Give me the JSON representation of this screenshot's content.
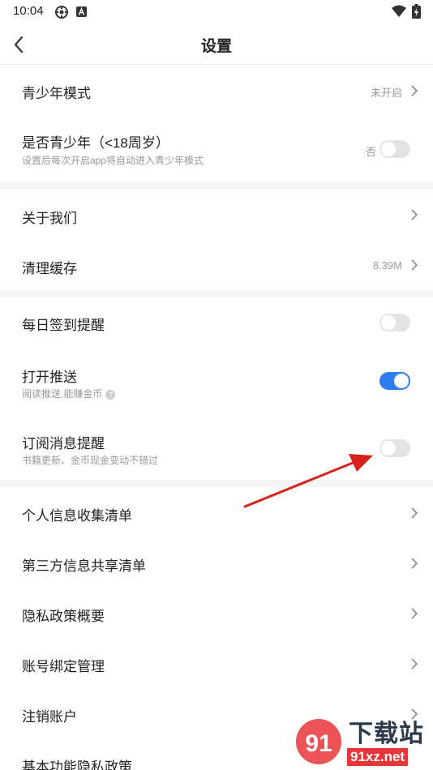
{
  "status": {
    "time": "10:04",
    "icons": [
      "location-icon",
      "a-badge-icon",
      "wifi-icon",
      "battery-icon"
    ]
  },
  "header": {
    "title": "设置",
    "back_icon": "chevron-left-icon"
  },
  "section1": {
    "youth_mode": {
      "label": "青少年模式",
      "value": "未开启"
    },
    "is_youth": {
      "label": "是否青少年（<18周岁）",
      "sub": "设置后每次开启app将自动进入青少年模式",
      "value": "否",
      "enabled": false
    }
  },
  "section2": {
    "about": {
      "label": "关于我们"
    },
    "cache": {
      "label": "清理缓存",
      "value": "8.39M"
    }
  },
  "section3": {
    "checkin": {
      "label": "每日签到提醒",
      "enabled": false
    },
    "push": {
      "label": "打开推送",
      "sub": "阅读推送,能赚金币",
      "help": "?",
      "enabled": true
    },
    "subscribe": {
      "label": "订阅消息提醒",
      "sub": "书籍更新、金币现金变动不错过",
      "enabled": false
    }
  },
  "section4": {
    "items": [
      {
        "label": "个人信息收集清单"
      },
      {
        "label": "第三方信息共享清单"
      },
      {
        "label": "隐私政策概要"
      },
      {
        "label": "账号绑定管理"
      },
      {
        "label": "注销账户"
      },
      {
        "label": "基本功能隐私政策"
      }
    ]
  },
  "watermark": {
    "brand": "下载站",
    "site": "91xz.net"
  },
  "colors": {
    "toggle_on": "#2e7cf2",
    "toggle_off": "#e4e4e4",
    "arrow": "#d8201c",
    "section_gap": "#f4f4f4"
  }
}
